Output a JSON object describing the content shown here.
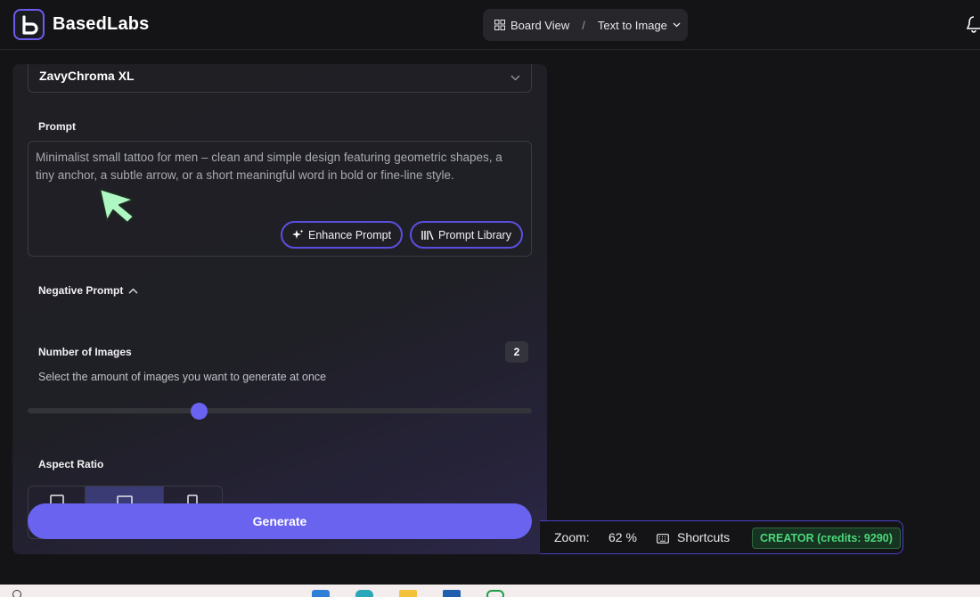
{
  "header": {
    "brand": "BasedLabs",
    "breadcrumb": {
      "view": "Board View",
      "separator": "/",
      "page": "Text to Image"
    }
  },
  "panel": {
    "model": "ZavyChroma XL",
    "prompt_label": "Prompt",
    "prompt_text": "Minimalist small tattoo for men – clean and simple design featuring geometric shapes, a tiny anchor, a subtle arrow, or a short meaningful word in bold or fine-line style.",
    "enhance_label": "Enhance Prompt",
    "library_label": "Prompt Library",
    "negative_label": "Negative Prompt",
    "num_images_label": "Number of Images",
    "num_images_value": "2",
    "num_images_sub": "Select the amount of images you want to generate at once",
    "slider_fraction": 0.34,
    "aspect_label": "Aspect Ratio",
    "generate_label": "Generate"
  },
  "status": {
    "zoom_label": "Zoom:",
    "zoom_value": "62 %",
    "shortcuts_label": "Shortcuts",
    "credits": "CREATOR (credits: 9290)"
  },
  "colors": {
    "accent": "#6a63ef",
    "credits_green": "#4cd97b"
  }
}
